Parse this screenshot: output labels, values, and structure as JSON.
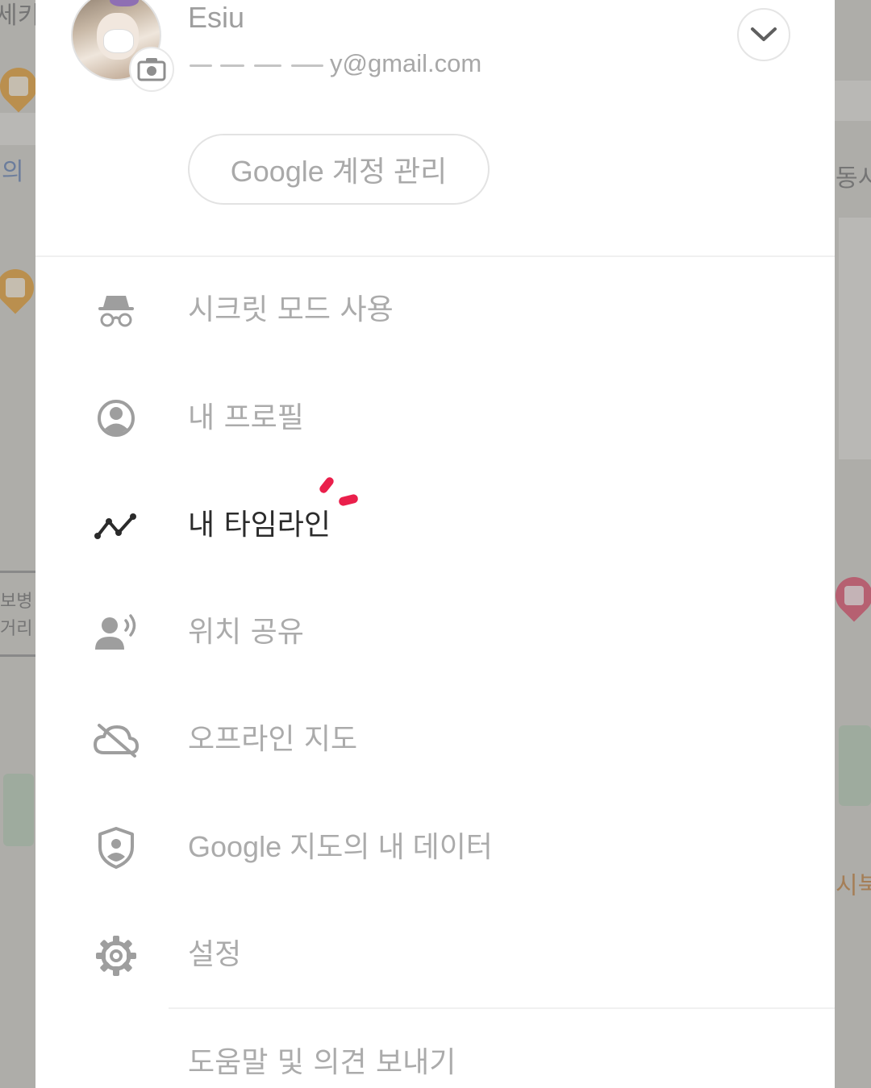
{
  "account": {
    "name": "Esiu",
    "email_visible": "y@gmail.com"
  },
  "manage_account_label": "Google 계정 관리",
  "menu": [
    {
      "label": "시크릿 모드 사용",
      "icon": "incognito-icon"
    },
    {
      "label": "내 프로필",
      "icon": "account-circle-icon"
    },
    {
      "label": "내 타임라인",
      "icon": "timeline-icon",
      "active": true
    },
    {
      "label": "위치 공유",
      "icon": "location-sharing-icon"
    },
    {
      "label": "오프라인 지도",
      "icon": "offline-cloud-icon"
    },
    {
      "label": "Google 지도의 내 데이터",
      "icon": "shield-account-icon"
    },
    {
      "label": "설정",
      "icon": "gear-icon"
    },
    {
      "label": "도움말 및 의견 보내기",
      "icon": ""
    }
  ],
  "background_map": {
    "labels": [
      "세키",
      "의",
      "동시",
      "보병",
      "거리",
      "시북"
    ]
  },
  "colors": {
    "drawer_bg": "#ffffff",
    "inactive_text": "#ababab",
    "active_text": "#2b2b2b",
    "annotation_red": "#ea1f4b"
  }
}
